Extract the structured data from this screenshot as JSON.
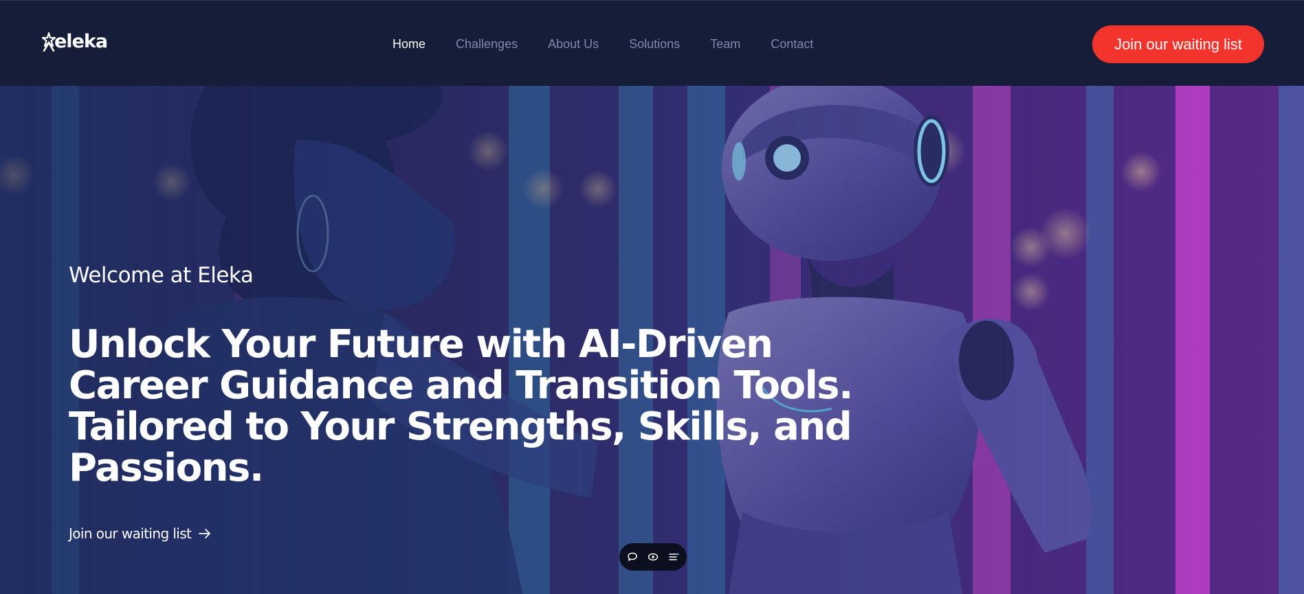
{
  "header": {
    "logo_text": "eleka",
    "nav": [
      {
        "label": "Home",
        "active": true
      },
      {
        "label": "Challenges",
        "active": false
      },
      {
        "label": "About Us",
        "active": false
      },
      {
        "label": "Solutions",
        "active": false
      },
      {
        "label": "Team",
        "active": false
      },
      {
        "label": "Contact",
        "active": false
      }
    ],
    "cta_label": "Join our waiting list"
  },
  "hero": {
    "welcome": "Welcome at Eleka",
    "headline_lines": [
      "Unlock Your Future with AI-Driven",
      "Career Guidance and Transition Tools.",
      "Tailored to Your Strengths, Skills, and",
      "Passions."
    ],
    "link_label": "Join our waiting list",
    "link_icon": "arrow-right-icon",
    "image_subject": "woman-and-robot-illustration"
  },
  "toolbar": {
    "icons": [
      "chat-bubble-icon",
      "eye-toggle-icon",
      "menu-list-icon"
    ]
  },
  "colors": {
    "header_bg": "#161d39",
    "accent": "#f3342c",
    "nav_inactive": "#8088b0",
    "nav_active": "#ffffff"
  }
}
